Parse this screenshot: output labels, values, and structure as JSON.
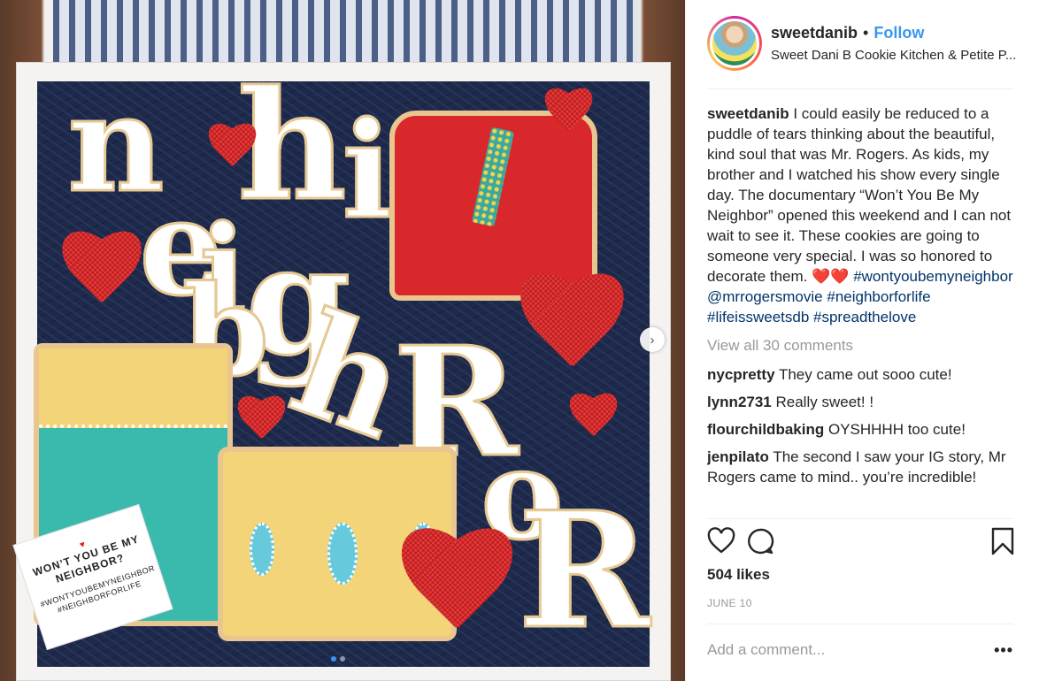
{
  "post": {
    "author": {
      "username": "sweetdanib",
      "follow_label": "Follow",
      "separator": "•",
      "location": "Sweet Dani B Cookie Kitchen & Petite P..."
    },
    "caption": {
      "username": "sweetdanib",
      "text": "I could easily be reduced to a puddle of tears thinking about the beautiful, kind soul that was Mr. Rogers. As kids, my brother and I watched his show every single day. The documentary “Won’t You Be My Neighbor” opened this weekend and I can not wait to see it. These cookies are going to someone very special. I was so honored to decorate them. ❤️❤️",
      "hashtags": [
        "#wontyoubemyneighbor",
        "@mrrogersmovie",
        "#neighborforlife",
        "#lifeissweetsdb",
        "#spreadthelove"
      ]
    },
    "view_all_comments": "View all 30 comments",
    "comments": [
      {
        "username": "nycpretty",
        "text": "They came out sooo cute!"
      },
      {
        "username": "lynn2731",
        "text": "Really sweet! !"
      },
      {
        "username": "flourchildbaking",
        "text": "OYSHHHH too cute!"
      },
      {
        "username": "jenpilato",
        "text": "The second I saw your IG story, Mr Rogers came to mind.. you’re incredible!"
      }
    ],
    "actions": {
      "like_icon": "heart-outline-icon",
      "comment_icon": "comment-bubble-icon",
      "save_icon": "bookmark-icon"
    },
    "likes": "504 likes",
    "date": "JUNE 10",
    "add_comment_placeholder": "Add a comment...",
    "more_options": "•••"
  },
  "photo": {
    "cookie_letters": [
      "n",
      "h",
      "i",
      "e",
      "i",
      "g",
      "h",
      "b",
      "o",
      "R",
      "o",
      "R"
    ],
    "tag_heading": "WON’T YOU BE MY NEIGHBOR?",
    "tag_hashtags": "#WONTYOUBEMYNEIGHBOR #NEIGHBORFORLIFE",
    "carousel_total": 2,
    "carousel_active": 1
  },
  "colors": {
    "link_blue": "#3897f0",
    "hashtag_blue": "#003569",
    "muted_gray": "#999999"
  }
}
